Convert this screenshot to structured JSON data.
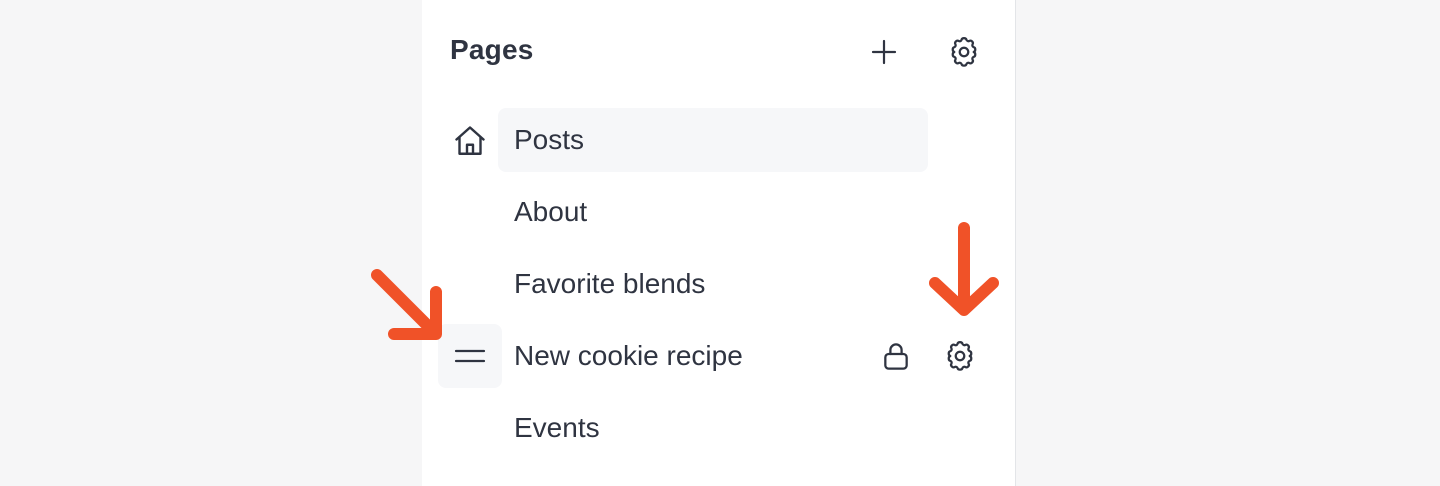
{
  "panel": {
    "title": "Pages"
  },
  "actions": {
    "add_icon": "plus-icon",
    "settings_icon": "gear-icon"
  },
  "pages": [
    {
      "label": "Posts",
      "icon": "home-icon",
      "active": true
    },
    {
      "label": "About"
    },
    {
      "label": "Favorite blends"
    },
    {
      "label": "New cookie recipe",
      "icons": [
        "drag-handle-icon",
        "lock-icon",
        "gear-icon"
      ]
    },
    {
      "label": "Events"
    }
  ],
  "colors": {
    "background": "#f6f6f7",
    "panel": "#ffffff",
    "text": "#2f3441",
    "active_row": "#f6f7f9",
    "annotation_arrow": "#f05228"
  }
}
